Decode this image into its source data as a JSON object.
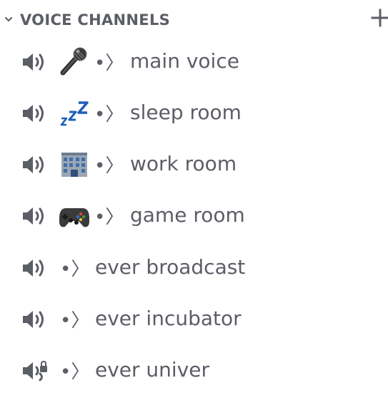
{
  "category": {
    "title": "VOICE CHANNELS",
    "icons": {
      "collapse": "chevron-down-icon",
      "add": "plus-icon"
    }
  },
  "channels": [
    {
      "emoji_icon": "microphone-icon",
      "separator": "•〉",
      "name": "main voice",
      "icon": "speaker-icon"
    },
    {
      "emoji_icon": "zzz-icon",
      "separator": "•〉",
      "name": "sleep room",
      "icon": "speaker-icon"
    },
    {
      "emoji_icon": "office-building-icon",
      "separator": "•〉",
      "name": "work room",
      "icon": "speaker-icon"
    },
    {
      "emoji_icon": "game-controller-icon",
      "separator": "•〉",
      "name": "game room",
      "icon": "speaker-icon"
    },
    {
      "emoji_icon": "",
      "separator": "•〉",
      "name": "ever broadcast",
      "icon": "speaker-icon"
    },
    {
      "emoji_icon": "",
      "separator": "•〉",
      "name": "ever incubator",
      "icon": "speaker-icon"
    },
    {
      "emoji_icon": "",
      "separator": "•〉",
      "name": "ever univer",
      "icon": "locked-speaker-icon"
    }
  ],
  "colors": {
    "text": "#5c5e66",
    "background": "#ffffff",
    "zzz_blue": "#1f5fb8"
  }
}
